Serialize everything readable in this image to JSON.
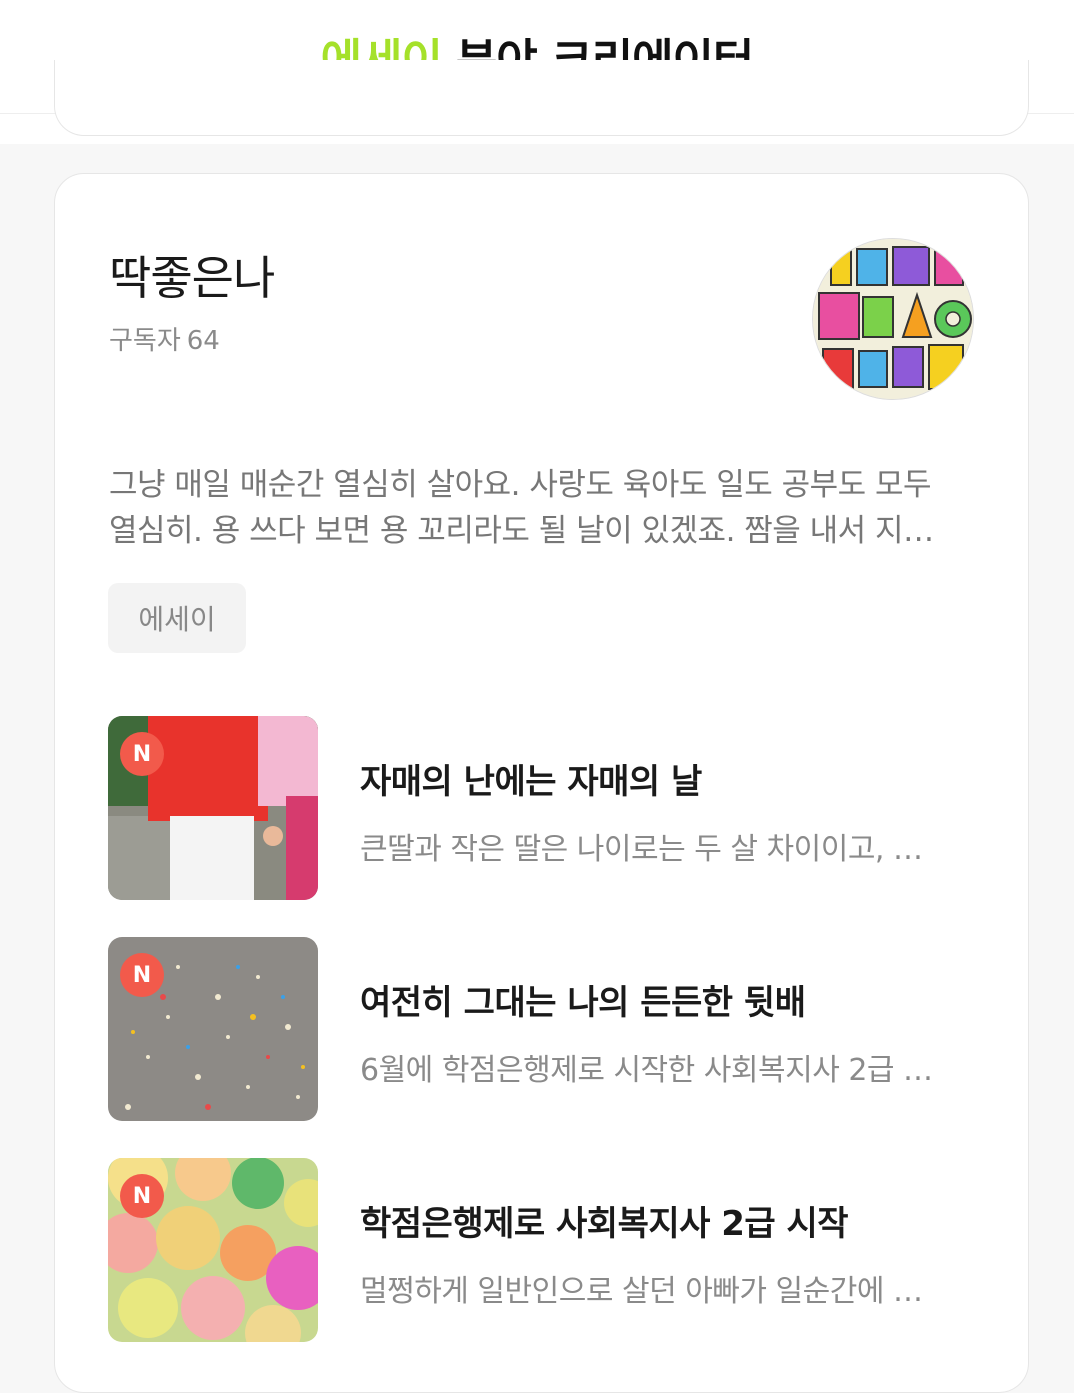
{
  "header": {
    "accent_word": "에세이",
    "rest_title": "분야 크리에이터",
    "accent_color": "#a5e12a"
  },
  "creator": {
    "name": "딱좋은나",
    "subscribers_label": "구독자",
    "subscribers_count": "64",
    "description_line1": "그냥 매일 매순간 열심히 살아요. 사랑도 육아도 일도 공부도 모두",
    "description_line2": "열심히. 용 쓰다 보면 용 꼬리라도 될 날이 있겠죠. 짬을 내서 지…",
    "tag": "에세이"
  },
  "posts": [
    {
      "badge": "N",
      "title": "자매의 난에는 자매의 날",
      "excerpt": "큰딸과 작은 딸은 나이로는 두 살 차이이고, …"
    },
    {
      "badge": "N",
      "title": "여전히 그대는 나의 든든한 뒷배",
      "excerpt": "6월에 학점은행제로 시작한 사회복지사 2급 …"
    },
    {
      "badge": "N",
      "title": "학점은행제로 사회복지사 2급 시작",
      "excerpt": "멀쩡하게 일반인으로 살던 아빠가 일순간에 …"
    }
  ],
  "colors": {
    "badge": "#f25a4b",
    "text_primary": "#1a1a1a",
    "text_secondary": "#8a8a8a"
  }
}
